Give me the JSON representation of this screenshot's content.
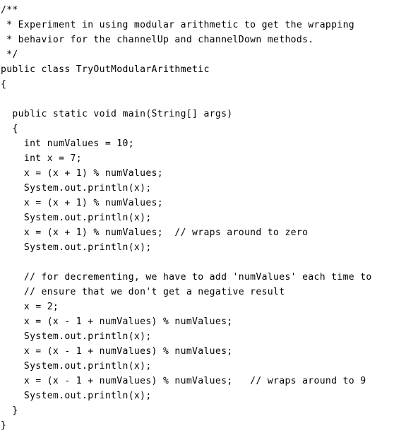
{
  "document": {
    "type": "source-code-listing",
    "language": "Java",
    "class_name": "TryOutModularArithmetic",
    "background_color": "#ffffff",
    "text_color": "#000000",
    "lines": [
      "/**",
      " * Experiment in using modular arithmetic to get the wrapping",
      " * behavior for the channelUp and channelDown methods.",
      " */",
      "public class TryOutModularArithmetic",
      "{",
      "",
      "  public static void main(String[] args)",
      "  {",
      "    int numValues = 10;",
      "    int x = 7;",
      "    x = (x + 1) % numValues;",
      "    System.out.println(x);",
      "    x = (x + 1) % numValues;",
      "    System.out.println(x);",
      "    x = (x + 1) % numValues;  // wraps around to zero",
      "    System.out.println(x);",
      "",
      "    // for decrementing, we have to add 'numValues' each time to",
      "    // ensure that we don't get a negative result",
      "    x = 2;",
      "    x = (x - 1 + numValues) % numValues;",
      "    System.out.println(x);",
      "    x = (x - 1 + numValues) % numValues;",
      "    System.out.println(x);",
      "    x = (x - 1 + numValues) % numValues;   // wraps around to 9",
      "    System.out.println(x);",
      "  }",
      "}"
    ]
  }
}
